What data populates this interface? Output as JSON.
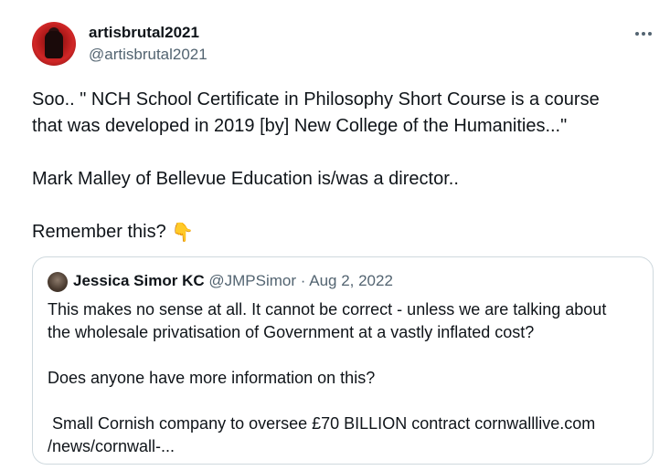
{
  "author": {
    "display_name": "artisbrutal2021",
    "handle": "@artisbrutal2021",
    "avatar_color": "#c41e1e"
  },
  "menu": {
    "icon": "more-horizontal-icon"
  },
  "tweet": {
    "lines": [
      "Soo.. \" NCH School Certificate in Philosophy Short Course is a course",
      "that was developed in 2019 [by] New College of the Humanities...\"",
      "Mark Malley of Bellevue Education is/was a director..",
      "Remember this?"
    ],
    "emoji": "👇",
    "emoji_name": "backhand-index-pointing-down-icon"
  },
  "quoted": {
    "display_name": "Jessica Simor KC",
    "handle": "@JMPSimor",
    "separator": "·",
    "date": "Aug 2, 2022",
    "lines": [
      "This makes no sense at all.  It cannot be correct - unless we are talking about",
      "the wholesale privatisation of Government at a vastly inflated cost?",
      "Does anyone have more information on this?",
      " Small Cornish company to oversee £70 BILLION contract cornwalllive.com",
      "/news/cornwall-..."
    ]
  },
  "colors": {
    "text": "#0f1419",
    "secondary": "#536471",
    "border": "#cfd9de"
  }
}
